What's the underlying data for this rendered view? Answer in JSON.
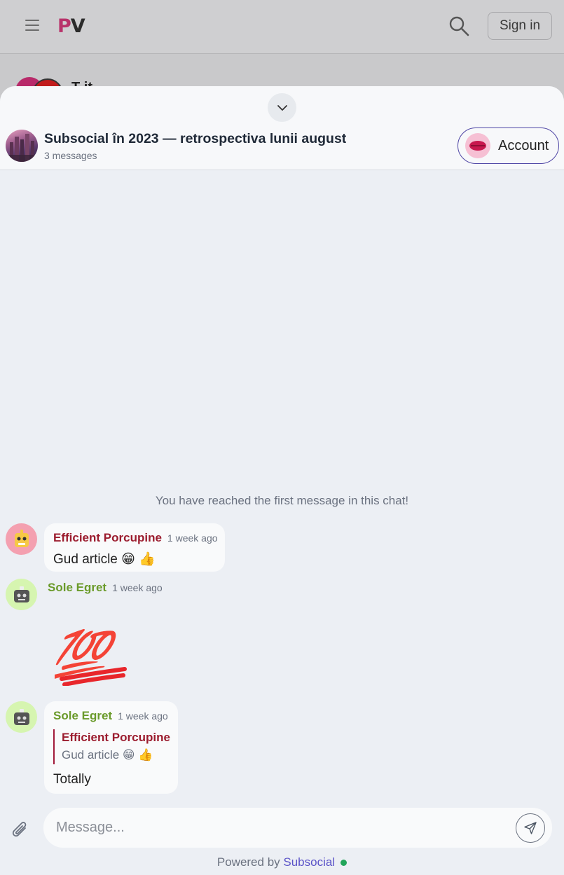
{
  "nav": {
    "logo_p": "P",
    "logo_v": "V",
    "signin_label": "Sign in",
    "bg_title_partial": "T   it"
  },
  "chat": {
    "title": "Subsocial în 2023 — retrospectiva lunii august",
    "subtitle": "3 messages",
    "account_label": "Account",
    "first_message_notice": "You have reached the first message in this chat!"
  },
  "messages": [
    {
      "author": "Efficient Porcupine",
      "author_color": "#9b1c2e",
      "time": "1 week ago",
      "text": "Gud article 😁 👍"
    },
    {
      "author": "Sole Egret",
      "author_color": "#6a9a2a",
      "time": "1 week ago",
      "text": "💯"
    },
    {
      "author": "Sole Egret",
      "author_color": "#6a9a2a",
      "time": "1 week ago",
      "reply_author": "Efficient Porcupine",
      "reply_text": "Gud article 😁 👍",
      "text": "Totally"
    }
  ],
  "composer": {
    "placeholder": "Message..."
  },
  "footer": {
    "powered_prefix": "Powered by",
    "brand": "Subsocial"
  },
  "colors": {
    "accent": "#5b54c8",
    "logo_p": "#b8336a",
    "online": "#22a55a"
  }
}
